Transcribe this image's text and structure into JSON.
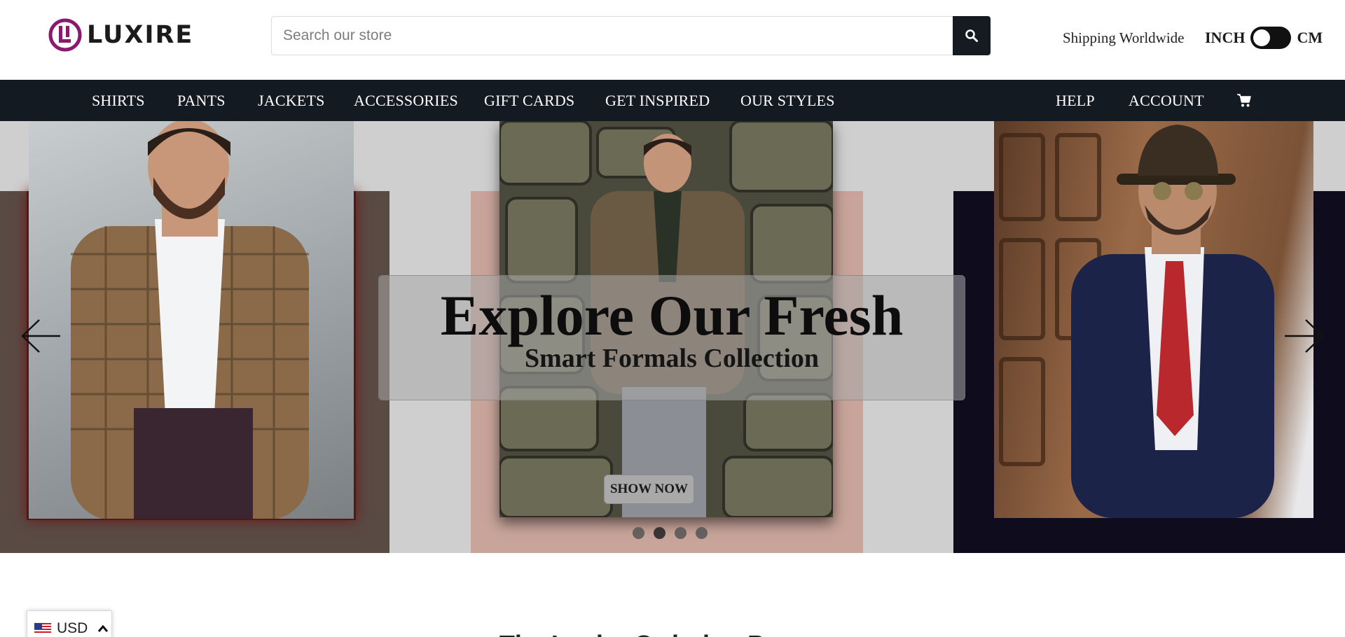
{
  "header": {
    "logo_text": "LUXIRE",
    "search_placeholder": "Search our store",
    "shipping": "Shipping Worldwide",
    "unit_left": "INCH",
    "unit_right": "CM"
  },
  "nav": {
    "items": [
      "SHIRTS",
      "PANTS",
      "JACKETS",
      "ACCESSORIES",
      "GIFT CARDS",
      "GET INSPIRED",
      "OUR STYLES"
    ],
    "help": "HELP",
    "account": "ACCOUNT",
    "cart_icon": "cart-icon"
  },
  "hero": {
    "title": "Explore Our Fresh",
    "subtitle": "Smart Formals Collection",
    "cta": "SHOW NOW",
    "slide_count": 4,
    "active_slide": 2,
    "prev_icon": "arrow-left-icon",
    "next_icon": "arrow-right-icon"
  },
  "section": {
    "title": "The Luxire Ordering Process"
  },
  "currency": {
    "code": "USD",
    "flag_icon": "us-flag-icon",
    "chevron_icon": "chevron-up-icon"
  },
  "colors": {
    "nav_bg": "#141a22",
    "brand_purple": "#8a1a6e",
    "hero_bg": "#cfcfcf"
  }
}
